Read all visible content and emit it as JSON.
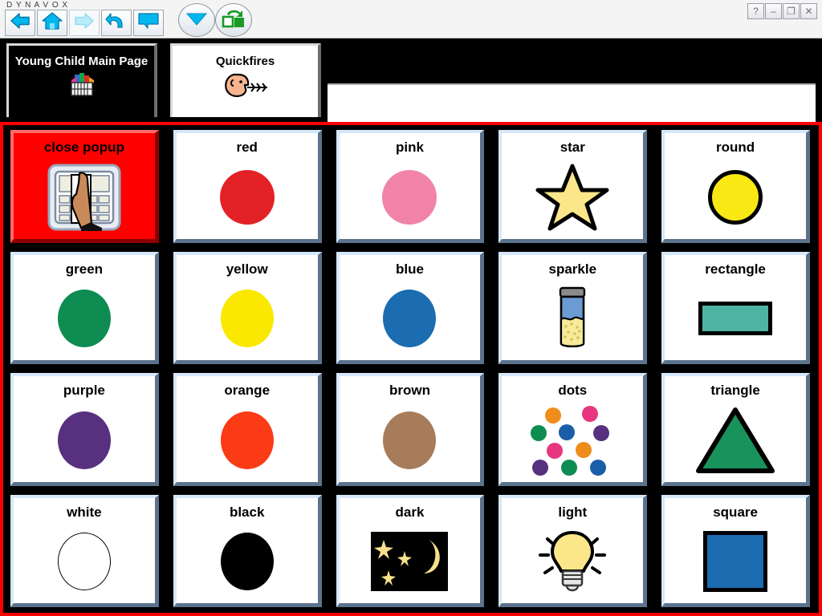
{
  "window": {
    "brand": "D Y N A V O X",
    "controls": [
      {
        "name": "help-button",
        "glyph": "?"
      },
      {
        "name": "minimize-button",
        "glyph": "–"
      },
      {
        "name": "restore-button",
        "glyph": "❐"
      },
      {
        "name": "close-button",
        "glyph": "✕"
      }
    ]
  },
  "toolbar": {
    "buttons": [
      {
        "id": "tb-back",
        "name": "back-button",
        "icon": "back-arrow-icon",
        "label": "Back",
        "enabled": true
      },
      {
        "id": "tb-home",
        "name": "home-button",
        "icon": "home-icon",
        "label": "Home",
        "enabled": true
      },
      {
        "id": "tb-fwd",
        "name": "forward-button",
        "icon": "forward-arrow-icon",
        "label": "Forward",
        "enabled": false
      },
      {
        "id": "tb-undo",
        "name": "undo-button",
        "icon": "undo-arrow-icon",
        "label": "Undo",
        "enabled": true
      },
      {
        "id": "tb-speak",
        "name": "speak-button",
        "icon": "speech-bubble-icon",
        "label": "Speak",
        "enabled": true
      }
    ],
    "round_buttons": [
      {
        "id": "tb-dropdown",
        "name": "dropdown-button",
        "icon": "triangle-down-icon",
        "label": "Dropdown",
        "color": "#00b0e8"
      },
      {
        "id": "tb-pages",
        "name": "page-swap-button",
        "icon": "page-swap-icon",
        "label": "Pages",
        "color": "#1a9b26"
      }
    ],
    "accent": "#00b0e8"
  },
  "tabs": [
    {
      "label": "Young Child Main Page",
      "icon": "toy-box-icon",
      "active": true,
      "text_color": "#ffffff",
      "background": "#000000"
    },
    {
      "label": "Quickfires",
      "icon": "speaking-face-icon",
      "active": false,
      "text_color": "#000000",
      "background": "#ffffff"
    }
  ],
  "grid": {
    "border_color": "#ff0000",
    "columns": 5,
    "rows": 4,
    "cells": [
      {
        "label": "close popup",
        "art": "close-popup-icon",
        "highlight": true,
        "highlight_color": "#ff0000"
      },
      {
        "label": "red",
        "art": "circle",
        "color": "#e32227"
      },
      {
        "label": "pink",
        "art": "circle",
        "color": "#f283a8"
      },
      {
        "label": "star",
        "art": "star",
        "color": "#fbe78a",
        "outline": "#000000"
      },
      {
        "label": "round",
        "art": "circle-outlined",
        "color": "#f9e814",
        "outline": "#000000"
      },
      {
        "label": "green",
        "art": "circle",
        "color": "#0e8c52"
      },
      {
        "label": "yellow",
        "art": "circle",
        "color": "#fae800"
      },
      {
        "label": "blue",
        "art": "circle",
        "color": "#1b6cb0"
      },
      {
        "label": "sparkle",
        "art": "glitter-jar-icon",
        "color": "#6b9bd2"
      },
      {
        "label": "rectangle",
        "art": "rectangle",
        "color": "#4fb3a4",
        "outline": "#000000"
      },
      {
        "label": "purple",
        "art": "circle",
        "color": "#57317f"
      },
      {
        "label": "orange",
        "art": "circle",
        "color": "#fb3b16"
      },
      {
        "label": "brown",
        "art": "circle",
        "color": "#a67c5b"
      },
      {
        "label": "dots",
        "art": "dots",
        "dot_colors": [
          "#ee8d1b",
          "#e8357f",
          "#0e8c52",
          "#1b5ea8",
          "#57317f",
          "#e8357f",
          "#ee8d1b",
          "#57317f",
          "#0e8c52",
          "#1b5ea8"
        ]
      },
      {
        "label": "triangle",
        "art": "triangle",
        "color": "#19925c",
        "outline": "#000000"
      },
      {
        "label": "white",
        "art": "circle-thin-outline",
        "color": "#ffffff",
        "outline": "#000000"
      },
      {
        "label": "black",
        "art": "circle",
        "color": "#000000"
      },
      {
        "label": "dark",
        "art": "night-sky-icon",
        "color": "#000000"
      },
      {
        "label": "light",
        "art": "light-bulb-icon",
        "color": "#fbe78a"
      },
      {
        "label": "square",
        "art": "square",
        "color": "#1b6cb0",
        "outline": "#000000"
      }
    ]
  }
}
